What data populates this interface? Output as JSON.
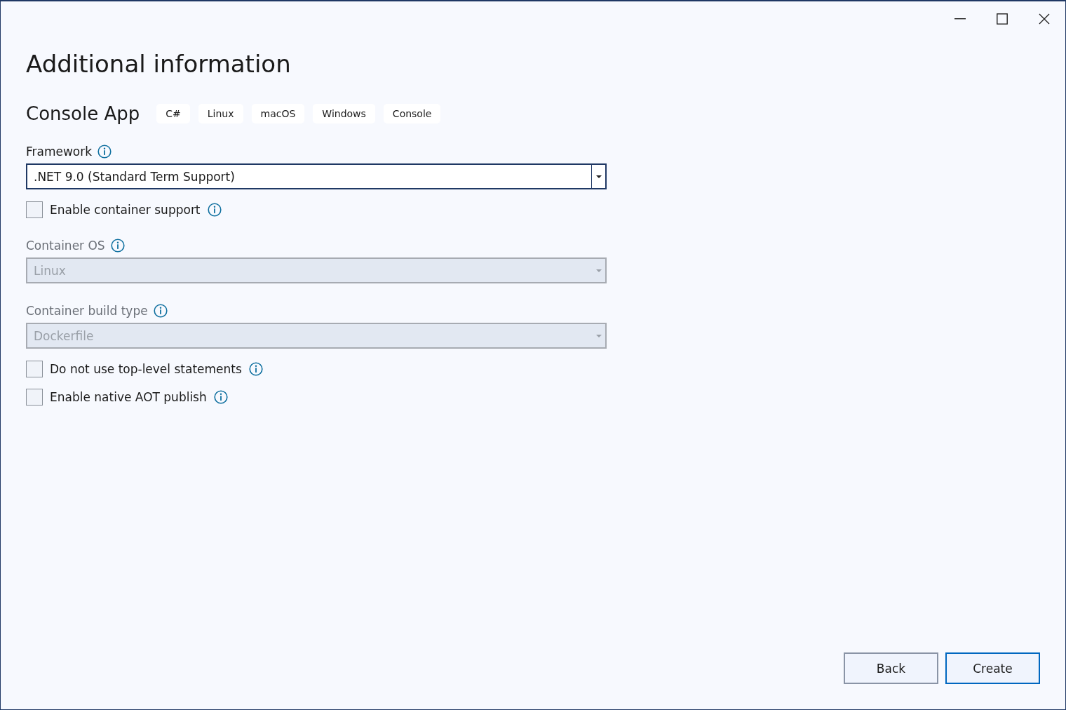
{
  "title": "Additional information",
  "template": {
    "name": "Console App",
    "tags": [
      "C#",
      "Linux",
      "macOS",
      "Windows",
      "Console"
    ]
  },
  "fields": [
    {
      "kind": "dropdown",
      "label": "Framework",
      "value": ".NET 9.0 (Standard Term Support)",
      "disabled": false
    },
    {
      "kind": "checkbox",
      "label": "Enable container support",
      "checked": false
    },
    {
      "kind": "dropdown",
      "label": "Container OS",
      "value": "Linux",
      "disabled": true
    },
    {
      "kind": "dropdown",
      "label": "Container build type",
      "value": "Dockerfile",
      "disabled": true
    },
    {
      "kind": "checkbox",
      "label": "Do not use top-level statements",
      "checked": false
    },
    {
      "kind": "checkbox",
      "label": "Enable native AOT publish",
      "checked": false
    }
  ],
  "buttons": [
    {
      "label": "Back",
      "focused": false
    },
    {
      "label": "Create",
      "focused": true
    }
  ]
}
